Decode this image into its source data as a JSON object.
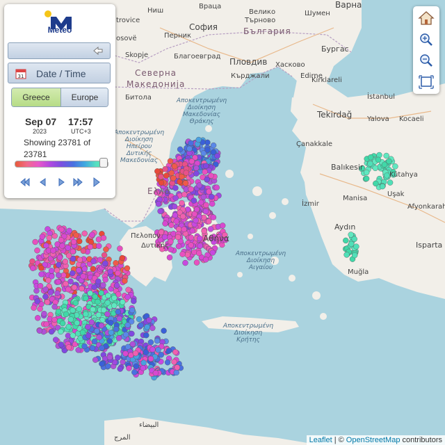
{
  "app": {
    "logo_text": "Meteo"
  },
  "panel": {
    "datetime_label": "Date / Time",
    "tabs": [
      {
        "label": "Greece",
        "active": true
      },
      {
        "label": "Europe",
        "active": false
      }
    ],
    "date": "Sep 07",
    "year": "2023",
    "time": "17:57",
    "timezone": "UTC+3",
    "showing_prefix": "Showing",
    "showing_count": "23781",
    "showing_of": "of",
    "showing_total": "23781",
    "slider_fraction": 1.0,
    "playback_controls": [
      "rewind-icon",
      "step-back-icon",
      "step-forward-icon",
      "fast-forward-icon",
      "play-icon"
    ]
  },
  "map_controls": [
    "home-icon",
    "zoom-in-icon",
    "zoom-out-icon",
    "fullscreen-icon"
  ],
  "map_labels": {
    "vratsa": "Враца",
    "veliko": "Велико",
    "tarnovo": "Търново",
    "shumen": "Шумен",
    "varna": "Варна",
    "nish": "Ниш",
    "trovice": "trovice",
    "sofia": "София",
    "pernik": "Перник",
    "bulgaria": "България",
    "osove": "osovë",
    "skopje": "Skopje",
    "blagoevgrad": "Благоевград",
    "plovdiv": "Пловдив",
    "haskovo": "Хасково",
    "burgas": "Бургас",
    "edirne": "Edirne",
    "kardzhali": "Кърджали",
    "kirklareli": "Kırklareli",
    "severna": "Северна",
    "makedonija": "Македонија",
    "istanbul": "İstanbul",
    "bitola": "Битола",
    "tekirdag": "Tekirdağ",
    "yalova": "Yalova",
    "kocaeli": "Kocaeli",
    "canakkale": "Çanakkale",
    "balikesir": "Balıkesir",
    "kutahya": "Kütahya",
    "usak": "Uşak",
    "izmir": "İzmir",
    "manisa": "Manisa",
    "afyonkarahisar": "Afyonkarahisar",
    "aydin": "Aydın",
    "isparta": "Isparta",
    "mugla": "Muğla",
    "ellada": "Ελλά",
    "athina": "Αθήνα",
    "peloponnisou": "Πελοπον",
    "ditikis": "Δυτικής",
    "admin_thrace_1": "Αποκεντρωμένη",
    "admin_thrace_2": "Διοίκηση",
    "admin_thrace_3": "Μακεδονίας",
    "admin_thrace_4": "Θράκης",
    "admin_epirus_1": "Αποκεντρωμένη",
    "admin_epirus_2": "Διοίκηση",
    "admin_epirus_3": "Ηπείρου",
    "admin_epirus_4": "Δυτικής",
    "admin_epirus_5": "Μακεδονίας",
    "aegean_1": "Αποκεντρωμένη",
    "aegean_2": "Διοίκηση",
    "aegean_3": "Αιγαίου",
    "crete_1": "Αποκεντρωμένη",
    "crete_2": "Διοίκηση",
    "crete_3": "Κρήτης",
    "libya_1": "البيضاء",
    "libya_2": "المرج"
  },
  "attribution": {
    "leaflet": "Leaflet",
    "sep": "|",
    "copy": "©",
    "osm": "OpenStreetMap",
    "contributors": "contributors"
  },
  "colors": {
    "accent_green": "#b6dc86",
    "panel_bg": "#ffffff",
    "sea": "#aad3df",
    "land": "#f2efe9"
  }
}
